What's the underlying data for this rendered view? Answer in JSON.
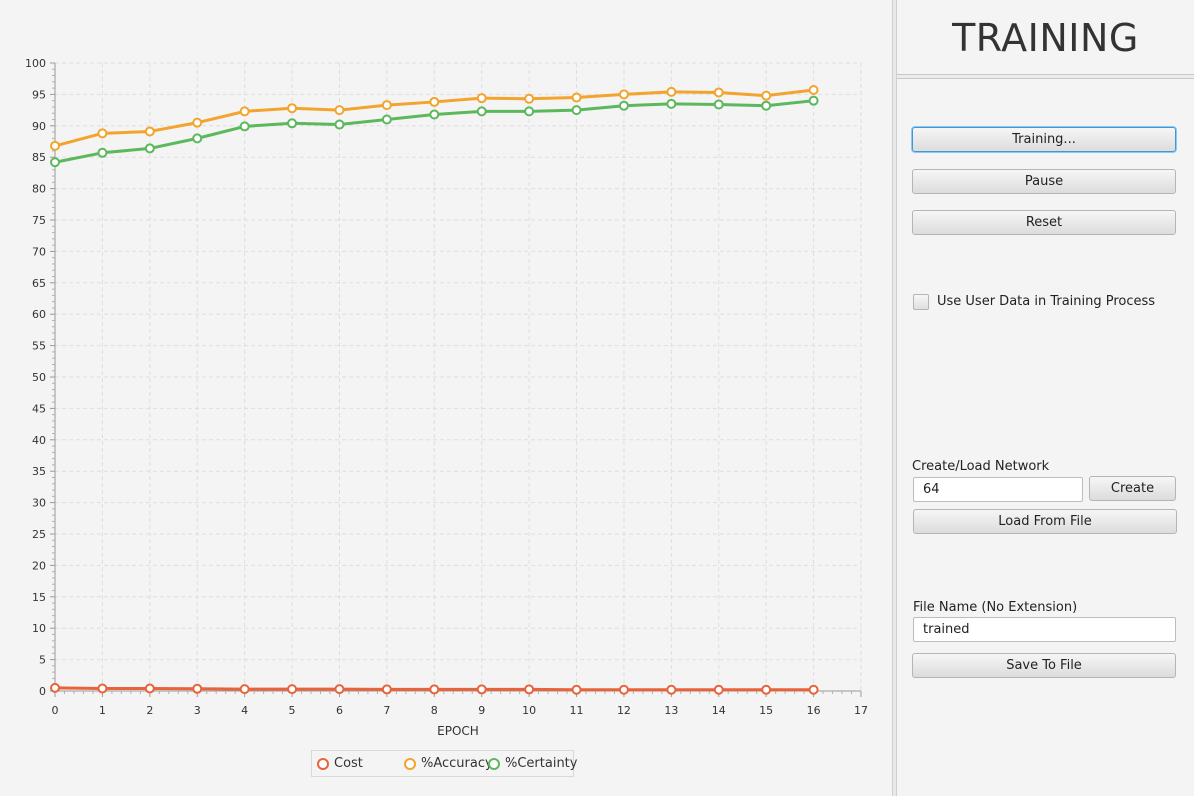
{
  "chart_data": {
    "type": "line",
    "xlabel": "EPOCH",
    "ylabel": "",
    "xlim": [
      0,
      17
    ],
    "ylim": [
      0,
      100
    ],
    "x_ticks": [
      0,
      1,
      2,
      3,
      4,
      5,
      6,
      7,
      8,
      9,
      10,
      11,
      12,
      13,
      14,
      15,
      16,
      17
    ],
    "y_ticks": [
      0,
      5,
      10,
      15,
      20,
      25,
      30,
      35,
      40,
      45,
      50,
      55,
      60,
      65,
      70,
      75,
      80,
      85,
      90,
      95,
      100
    ],
    "grid": true,
    "legend_position": "bottom",
    "x": [
      0,
      1,
      2,
      3,
      4,
      5,
      6,
      7,
      8,
      9,
      10,
      11,
      12,
      13,
      14,
      15,
      16
    ],
    "series": [
      {
        "name": "Cost",
        "color": "#e8633a",
        "values": [
          0.5,
          0.4,
          0.4,
          0.35,
          0.3,
          0.3,
          0.3,
          0.25,
          0.25,
          0.25,
          0.25,
          0.2,
          0.2,
          0.2,
          0.2,
          0.2,
          0.2
        ]
      },
      {
        "name": "%Accuracy",
        "color": "#f3a42e",
        "values": [
          86.8,
          88.8,
          89.1,
          90.5,
          92.3,
          92.8,
          92.5,
          93.3,
          93.8,
          94.4,
          94.3,
          94.5,
          95.0,
          95.4,
          95.3,
          94.8,
          95.7
        ]
      },
      {
        "name": "%Certainty",
        "color": "#5cb85c",
        "values": [
          84.2,
          85.7,
          86.4,
          88.0,
          89.9,
          90.4,
          90.2,
          91.0,
          91.8,
          92.3,
          92.3,
          92.5,
          93.2,
          93.5,
          93.4,
          93.2,
          94.0
        ]
      }
    ]
  },
  "panel": {
    "title": "TRAINING",
    "training_button": "Training...",
    "pause_button": "Pause",
    "reset_button": "Reset",
    "use_user_data_label": "Use User Data in Training Process",
    "use_user_data_checked": false,
    "network_label": "Create/Load Network",
    "network_value": "64",
    "create_button": "Create",
    "load_button": "Load From File",
    "filename_label": "File Name (No Extension)",
    "filename_value": "trained",
    "save_button": "Save To File"
  }
}
